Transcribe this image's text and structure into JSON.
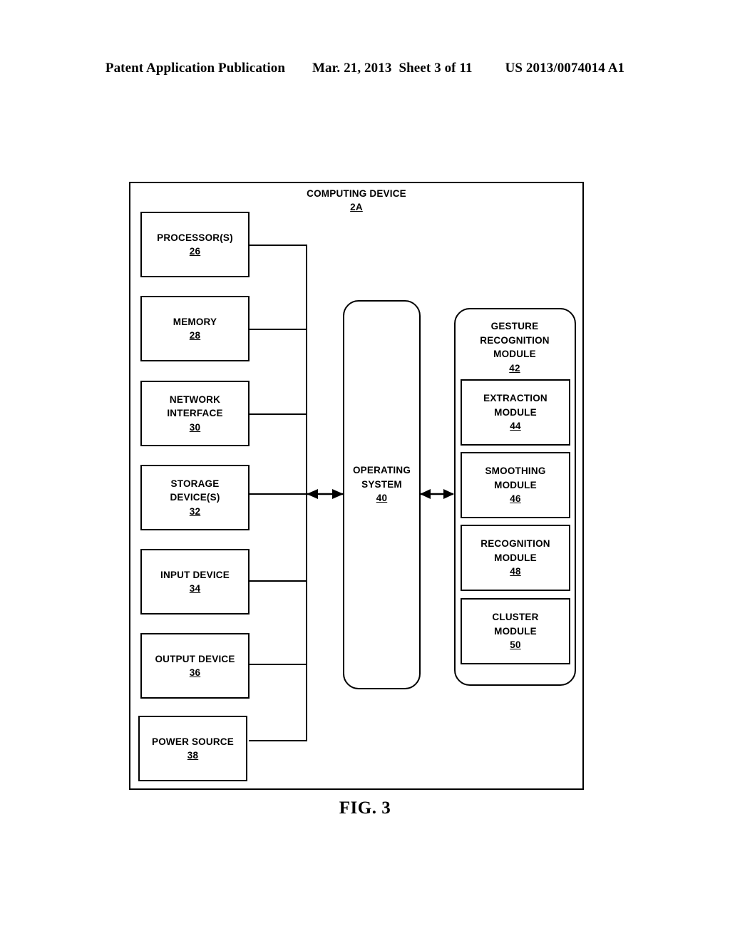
{
  "header": {
    "publication": "Patent Application Publication",
    "date": "Mar. 21, 2013",
    "sheet": "Sheet 3 of 11",
    "patent_number": "US 2013/0074014 A1"
  },
  "figure": {
    "caption": "FIG. 3",
    "device": {
      "title": "COMPUTING DEVICE",
      "ref": "2A"
    },
    "left_column": [
      {
        "label": "PROCESSOR(S)",
        "ref": "26"
      },
      {
        "label": "MEMORY",
        "ref": "28"
      },
      {
        "label": "NETWORK\nINTERFACE",
        "ref": "30"
      },
      {
        "label": "STORAGE\nDEVICE(S)",
        "ref": "32"
      },
      {
        "label": "INPUT DEVICE",
        "ref": "34"
      },
      {
        "label": "OUTPUT DEVICE",
        "ref": "36"
      },
      {
        "label": "POWER SOURCE",
        "ref": "38"
      }
    ],
    "operating_system": {
      "label_line1": "OPERATING",
      "label_line2": "SYSTEM",
      "ref": "40"
    },
    "gesture_module": {
      "label_line1": "GESTURE",
      "label_line2": "RECOGNITION",
      "label_line3": "MODULE",
      "ref": "42"
    },
    "sub_modules": [
      {
        "label_line1": "EXTRACTION",
        "label_line2": "MODULE",
        "ref": "44"
      },
      {
        "label_line1": "SMOOTHING",
        "label_line2": "MODULE",
        "ref": "46"
      },
      {
        "label_line1": "RECOGNITION",
        "label_line2": "MODULE",
        "ref": "48"
      },
      {
        "label_line1": "CLUSTER",
        "label_line2": "MODULE",
        "ref": "50"
      }
    ]
  },
  "colors": {
    "ink": "#000000",
    "paper": "#ffffff"
  }
}
